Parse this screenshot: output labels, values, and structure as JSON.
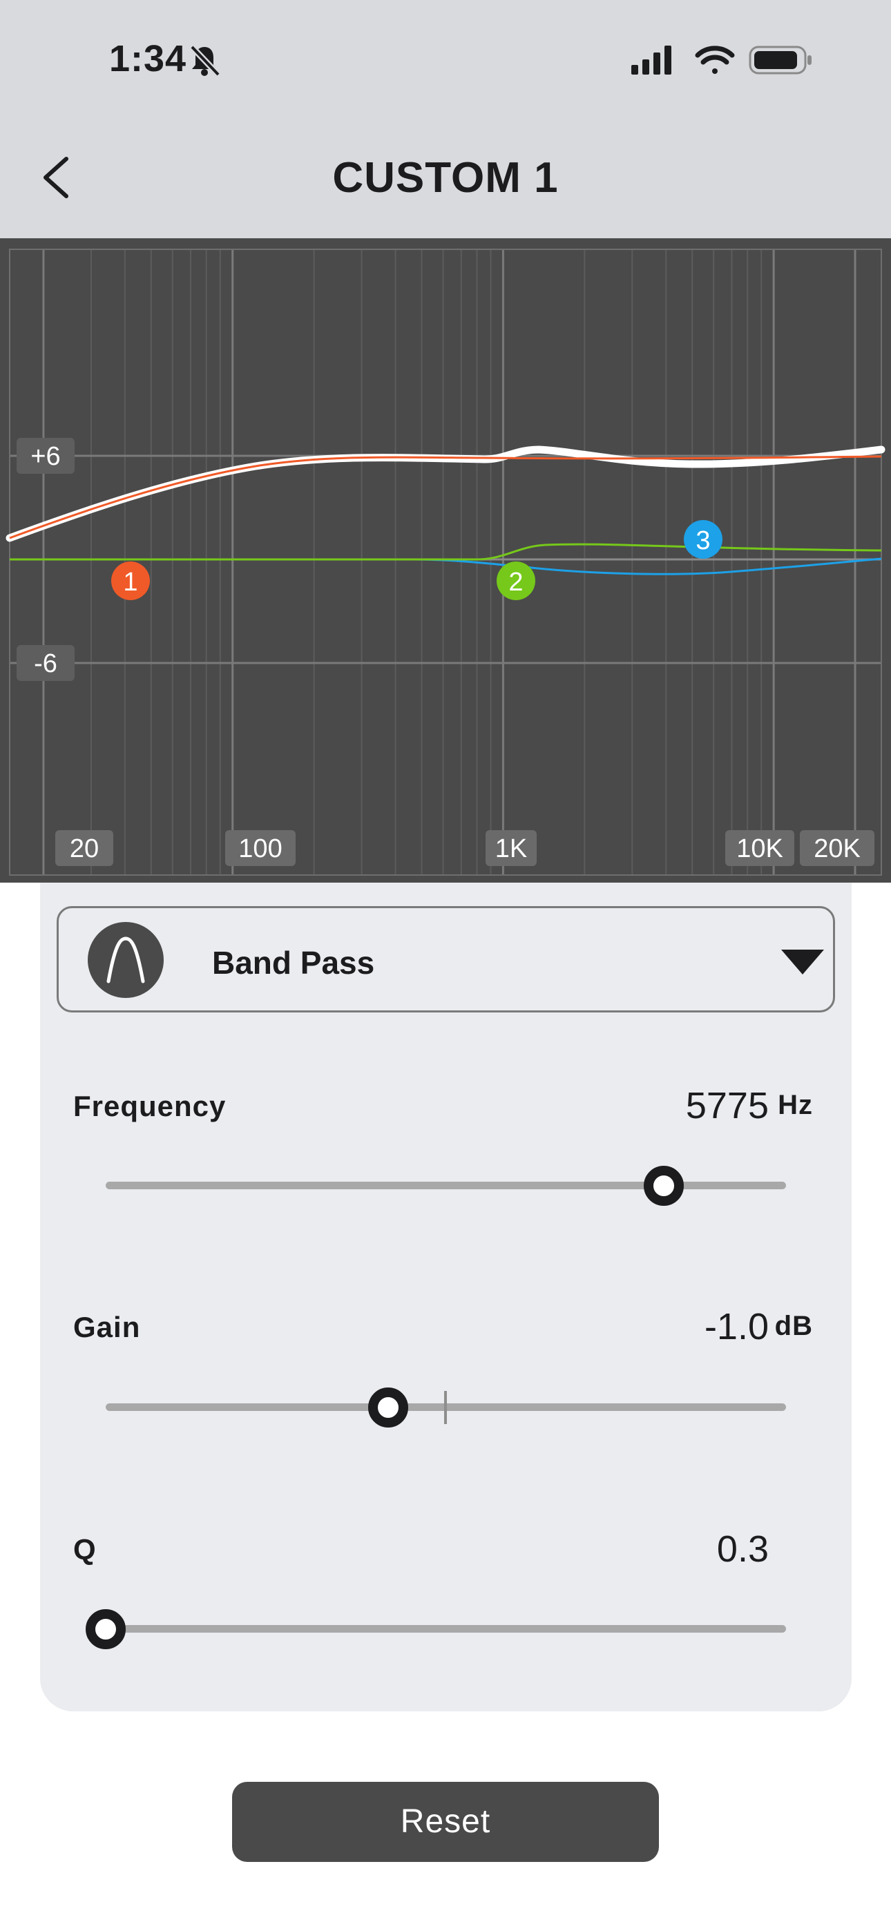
{
  "status_bar": {
    "time": "1:34"
  },
  "icons": {
    "bell": "bell-slash-icon",
    "signal": "cellular-signal-icon",
    "wifi": "wifi-icon",
    "battery": "battery-icon",
    "back": "chevron-left-icon",
    "filter": "band-pass-filter-icon",
    "caret": "triangle-down-icon"
  },
  "nav": {
    "title": "CUSTOM 1"
  },
  "eq_graph": {
    "y_tick_labels": [
      "+6",
      "-6"
    ],
    "x_tick_labels": [
      "20",
      "100",
      "1K",
      "10K",
      "20K"
    ],
    "band_markers": [
      {
        "label": "1",
        "color": "#f05a28"
      },
      {
        "label": "2",
        "color": "#76c81a"
      },
      {
        "label": "3",
        "color": "#1da1e8"
      }
    ],
    "curve_colors": {
      "total": "#ffffff",
      "band1": "#f05a28",
      "band2": "#76c81a",
      "band3": "#1da1e8"
    }
  },
  "filter": {
    "type_label": "Band Pass"
  },
  "params": {
    "frequency": {
      "label": "Frequency",
      "value": "5775",
      "unit": "Hz",
      "level": 0.82
    },
    "gain": {
      "label": "Gain",
      "value": "-1.0",
      "unit": "dB",
      "level": 0.415
    },
    "q": {
      "label": "Q",
      "value": "0.3",
      "level": 0.0
    }
  },
  "reset_label": "Reset"
}
